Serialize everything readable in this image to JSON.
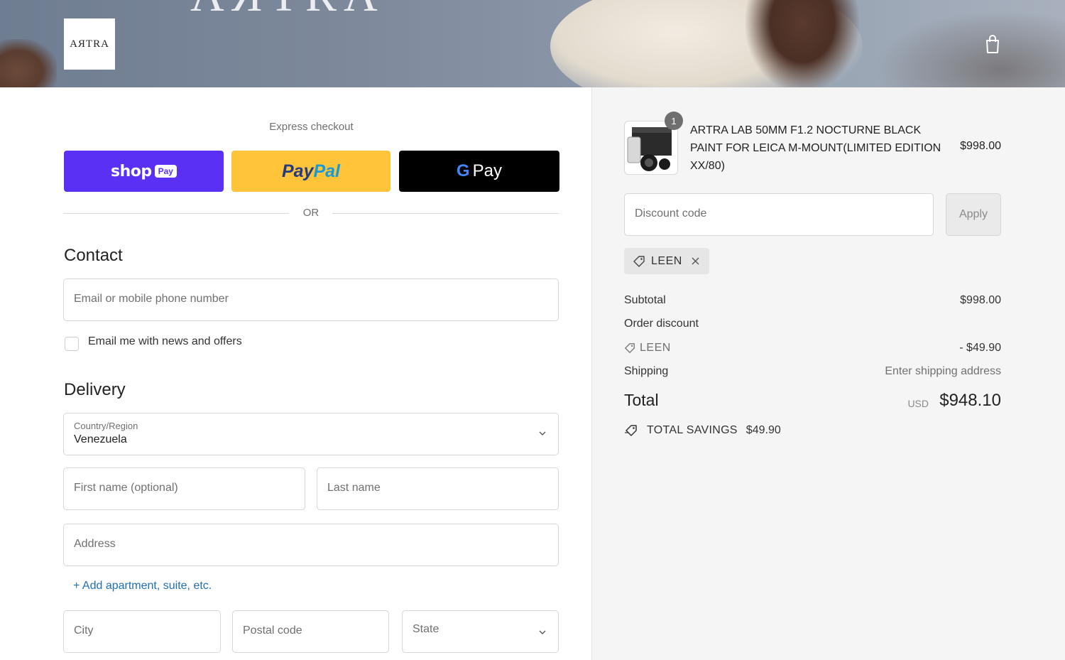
{
  "header": {
    "brand_ghost": "AЯTRA",
    "logo_text": "AЯTRA"
  },
  "express": {
    "label": "Express checkout",
    "shop_word": "shop",
    "shop_pill": "Pay",
    "paypal_a": "Pay",
    "paypal_b": "Pal",
    "gpay_g": "G",
    "gpay_text": "Pay",
    "or_text": "OR"
  },
  "contact": {
    "title": "Contact",
    "email_placeholder": "Email or mobile phone number",
    "newsletter_label": "Email me with news and offers"
  },
  "delivery": {
    "title": "Delivery",
    "country_label": "Country/Region",
    "country_value": "Venezuela",
    "first_name_placeholder": "First name (optional)",
    "last_name_placeholder": "Last name",
    "address_placeholder": "Address",
    "add_apartment": "+ Add apartment, suite, etc.",
    "city_placeholder": "City",
    "postal_placeholder": "Postal code",
    "state_placeholder": "State"
  },
  "order": {
    "quantity": "1",
    "product_title": "ARTRA LAB 50MM F1.2 NOCTURNE BLACK PAINT FOR LEICA M-MOUNT(LIMITED EDITION XX/80)",
    "product_price": "$998.00",
    "discount_placeholder": "Discount code",
    "apply_label": "Apply",
    "applied_code": "LEEN",
    "subtotal_label": "Subtotal",
    "subtotal_value": "$998.00",
    "order_discount_label": "Order discount",
    "discount_code_label": "LEEN",
    "discount_value": "- $49.90",
    "shipping_label": "Shipping",
    "shipping_value": "Enter shipping address",
    "total_label": "Total",
    "total_currency": "USD",
    "total_value": "$948.10",
    "savings_label": "TOTAL SAVINGS",
    "savings_value": "$49.90"
  },
  "colors": {
    "shop_pay": "#5a31f4",
    "paypal": "#ffc439",
    "gpay": "#000000",
    "link": "#1f6fb2"
  }
}
